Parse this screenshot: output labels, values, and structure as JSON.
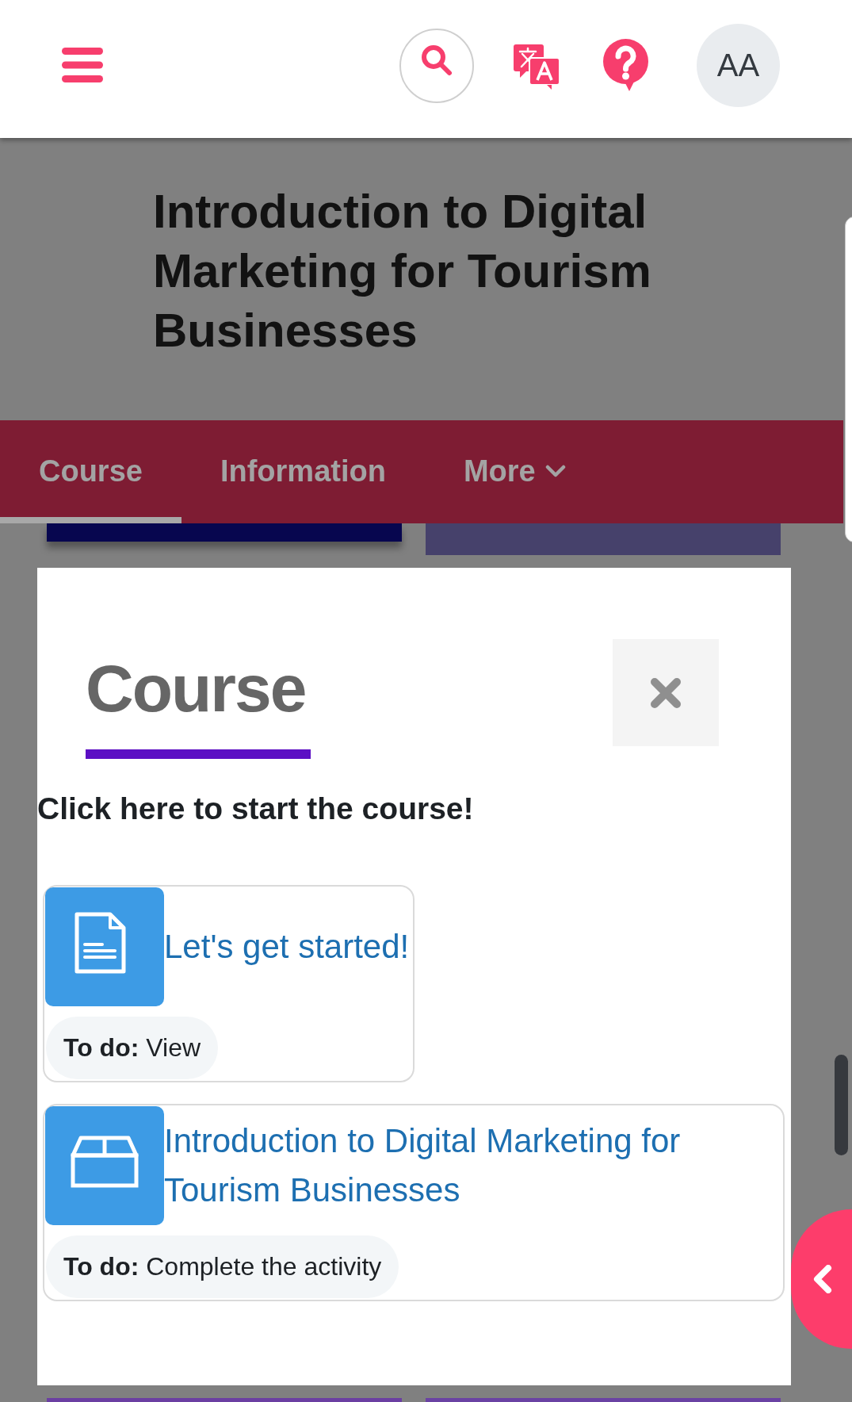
{
  "top_bar": {
    "avatar_initials": "AA"
  },
  "course": {
    "title": "Introduction to Digital Marketing for Tourism Businesses"
  },
  "tabs": [
    {
      "label": "Course",
      "selected": true,
      "kind": "link"
    },
    {
      "label": "Information",
      "selected": false,
      "kind": "link"
    },
    {
      "label": "More",
      "selected": false,
      "kind": "menu"
    }
  ],
  "dialog": {
    "title": "Course",
    "intro": "Click here to start the course!",
    "activities": [
      {
        "kind": "page",
        "title": "Let's get started!",
        "completion": "**To do:** View"
      },
      {
        "kind": "package",
        "title": "Introduction to Digital Marketing for Tourism Businesses",
        "completion": "**To do:** Complete the activity"
      }
    ]
  }
}
